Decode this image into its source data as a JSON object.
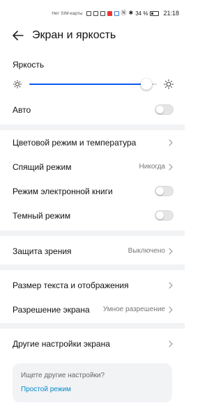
{
  "status_bar": {
    "sim_text": "Нет SIM-карты",
    "battery": "34 %",
    "time": "21:18"
  },
  "header": {
    "title": "Экран и яркость"
  },
  "brightness": {
    "label": "Яркость",
    "level_percent": 92
  },
  "auto": {
    "label": "Авто",
    "enabled": false
  },
  "group1": [
    {
      "label": "Цветовой режим и температура",
      "value": ""
    },
    {
      "label": "Спящий режим",
      "value": "Никогда"
    },
    {
      "label": "Режим электронной книги",
      "toggle": false
    },
    {
      "label": "Темный режим",
      "toggle": false
    }
  ],
  "group2": [
    {
      "label": "Защита зрения",
      "value": "Выключено"
    }
  ],
  "group3": [
    {
      "label": "Размер текста и отображения",
      "value": ""
    },
    {
      "label": "Разрешение экрана",
      "value": "Умное разрешение"
    }
  ],
  "group4": [
    {
      "label": "Другие настройки экрана",
      "value": ""
    }
  ],
  "search_card": {
    "question": "Ищете другие настройки?",
    "link": "Простой режим"
  },
  "colors": {
    "accent": "#0a59f7",
    "link": "#0a8acb",
    "divider": "#f1f3f5"
  }
}
